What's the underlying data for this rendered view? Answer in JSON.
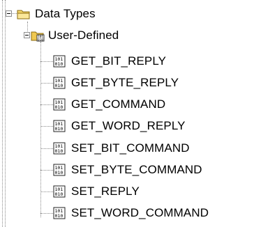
{
  "tree": {
    "root": {
      "label": "Data Types",
      "expanded": true
    },
    "group": {
      "label": "User-Defined",
      "expanded": true
    },
    "items": [
      {
        "label": "GET_BIT_REPLY",
        "icon": "binary-datatype-icon"
      },
      {
        "label": "GET_BYTE_REPLY",
        "icon": "binary-datatype-icon"
      },
      {
        "label": "GET_COMMAND",
        "icon": "binary-datatype-icon"
      },
      {
        "label": "GET_WORD_REPLY",
        "icon": "binary-datatype-icon"
      },
      {
        "label": "SET_BIT_COMMAND",
        "icon": "binary-datatype-icon"
      },
      {
        "label": "SET_BYTE_COMMAND",
        "icon": "binary-datatype-icon"
      },
      {
        "label": "SET_REPLY",
        "icon": "binary-datatype-icon"
      },
      {
        "label": "SET_WORD_COMMAND",
        "icon": "binary-datatype-icon"
      }
    ]
  },
  "colors": {
    "folder_yellow": "#f4d66a",
    "folder_outline": "#8a6a10",
    "tree_lines": "#8a8a8a"
  }
}
